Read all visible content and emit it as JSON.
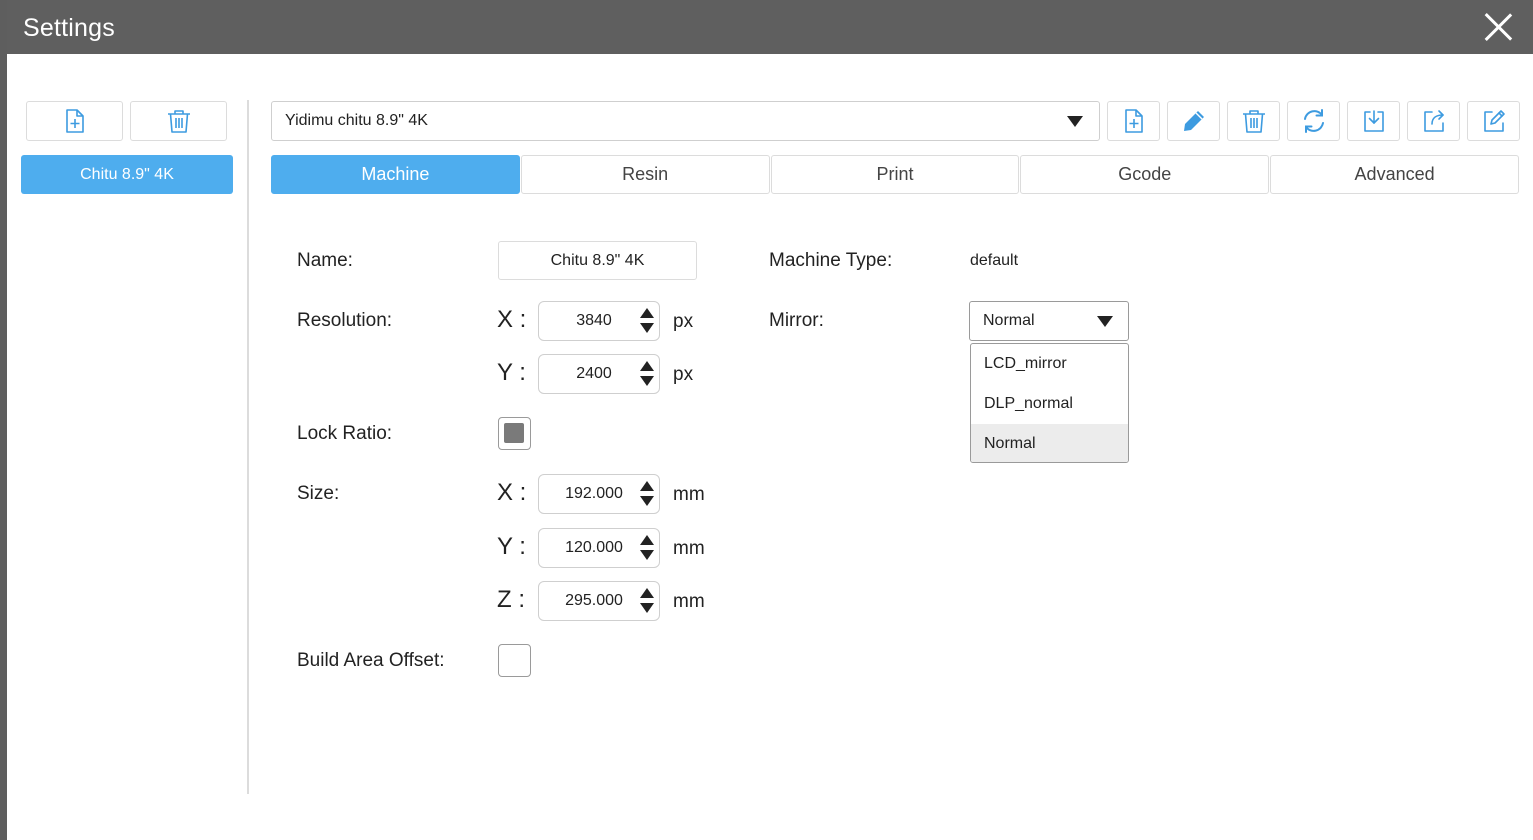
{
  "window": {
    "title": "Settings"
  },
  "sidebar": {
    "printers": [
      {
        "label": "Chitu 8.9\" 4K",
        "selected": true
      }
    ]
  },
  "profile": {
    "selected": "Yidimu chitu 8.9\" 4K",
    "toolbar_icons": [
      "new-file-icon",
      "edit-pencil-icon",
      "trash-icon",
      "refresh-icon",
      "import-icon",
      "export-icon",
      "share-edit-icon"
    ]
  },
  "tabs": [
    {
      "label": "Machine",
      "active": true
    },
    {
      "label": "Resin",
      "active": false
    },
    {
      "label": "Print",
      "active": false
    },
    {
      "label": "Gcode",
      "active": false
    },
    {
      "label": "Advanced",
      "active": false
    }
  ],
  "machine": {
    "name_label": "Name:",
    "name_value": "Chitu 8.9\" 4K",
    "machine_type_label": "Machine Type:",
    "machine_type_value": "default",
    "resolution_label": "Resolution:",
    "res_x_axis": "X :",
    "res_x": "3840",
    "res_y_axis": "Y :",
    "res_y": "2400",
    "px_unit": "px",
    "mirror_label": "Mirror:",
    "mirror_value": "Normal",
    "mirror_options": [
      "LCD_mirror",
      "DLP_normal",
      "Normal"
    ],
    "lock_ratio_label": "Lock Ratio:",
    "lock_ratio_checked": true,
    "size_label": "Size:",
    "size_x_axis": "X :",
    "size_x": "192.000",
    "size_y_axis": "Y :",
    "size_y": "120.000",
    "size_z_axis": "Z :",
    "size_z": "295.000",
    "mm_unit": "mm",
    "build_area_offset_label": "Build Area Offset:",
    "build_area_offset_checked": false
  },
  "colors": {
    "accent": "#4eadee",
    "titlebar": "#5f5f5f",
    "icon": "#3d9be0"
  }
}
